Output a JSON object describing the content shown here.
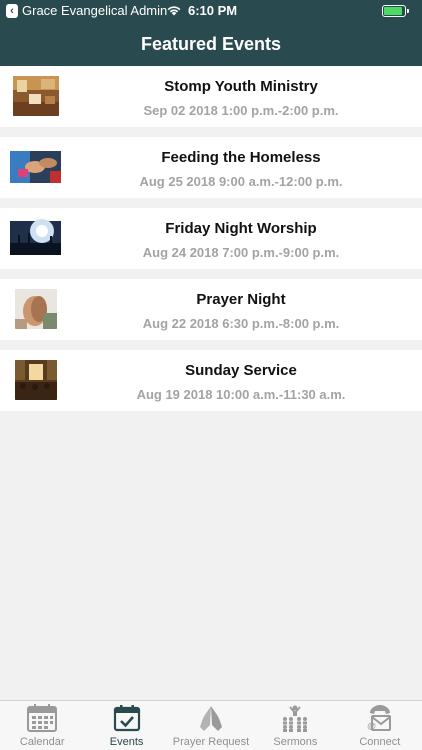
{
  "status_bar": {
    "back_app": "Grace Evangelical Admin",
    "time": "6:10 PM",
    "battery_level": 0.9
  },
  "nav": {
    "title": "Featured Events"
  },
  "events": [
    {
      "title": "Stomp Youth Ministry",
      "date": "Sep 02 2018 1:00 p.m.-2:00 p.m.",
      "thumb": "youth-room-photo"
    },
    {
      "title": "Feeding the Homeless",
      "date": "Aug 25 2018 9:00 a.m.-12:00 p.m.",
      "thumb": "hands-giving-photo"
    },
    {
      "title": "Friday Night Worship",
      "date": "Aug 24 2018 7:00 p.m.-9:00 p.m.",
      "thumb": "concert-crowd-photo"
    },
    {
      "title": "Prayer Night",
      "date": "Aug 22 2018 6:30 p.m.-8:00 p.m.",
      "thumb": "praying-hands-photo"
    },
    {
      "title": "Sunday Service",
      "date": "Aug 19 2018 10:00 a.m.-11:30 a.m.",
      "thumb": "church-service-photo"
    }
  ],
  "tabs": [
    {
      "label": "Calendar",
      "icon": "calendar-icon",
      "active": false
    },
    {
      "label": "Events",
      "icon": "events-icon",
      "active": true
    },
    {
      "label": "Prayer Request",
      "icon": "praying-hands-icon",
      "active": false
    },
    {
      "label": "Sermons",
      "icon": "sermons-icon",
      "active": false
    },
    {
      "label": "Connect",
      "icon": "phone-mail-icon",
      "active": false
    }
  ],
  "colors": {
    "brand": "#294a4f",
    "active_tab": "#294a4f",
    "inactive_tab": "#8f8f8f",
    "date_text": "#a3a3a3",
    "background": "#f1f1f1"
  }
}
